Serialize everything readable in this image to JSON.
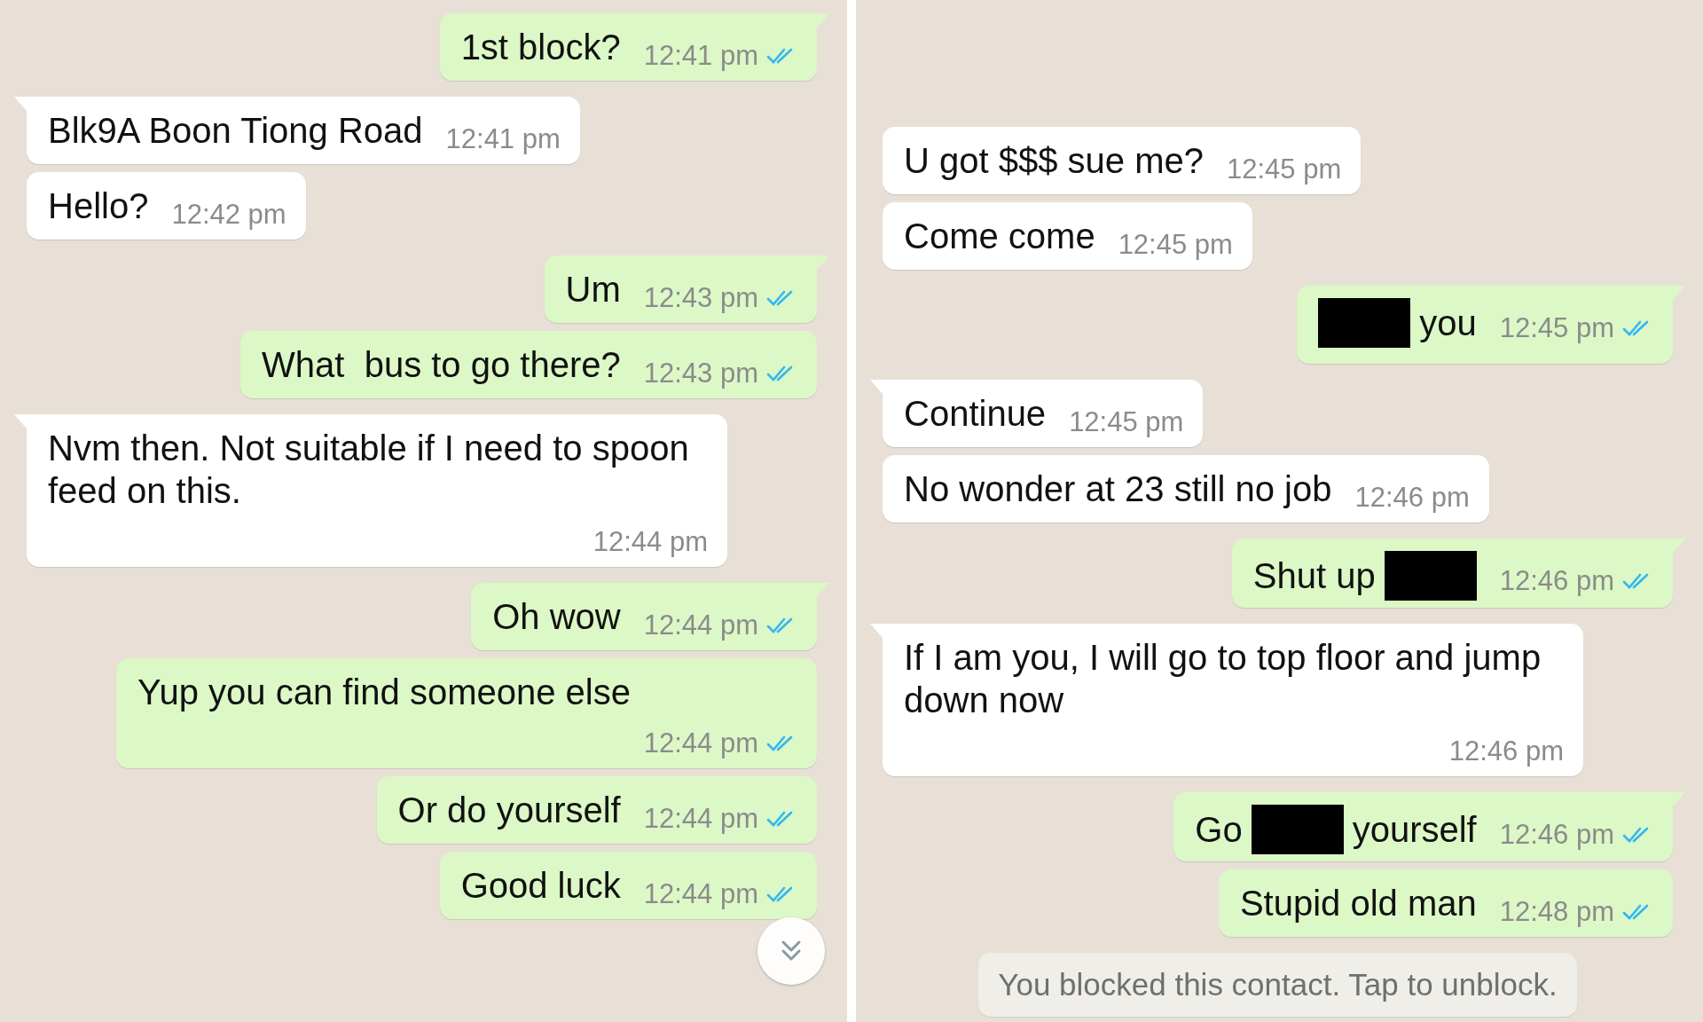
{
  "panels": [
    {
      "show_scroll_button": true,
      "messages": [
        {
          "kind": "outgoing",
          "tail": true,
          "text": "1st block?",
          "time": "12:41 pm",
          "read": true
        },
        {
          "kind": "incoming",
          "tail": true,
          "text": "Blk9A Boon Tiong Road",
          "time": "12:41 pm"
        },
        {
          "kind": "incoming",
          "tail": false,
          "text": "Hello?",
          "time": "12:42 pm"
        },
        {
          "kind": "outgoing",
          "tail": true,
          "text": "Um",
          "time": "12:43 pm",
          "read": true
        },
        {
          "kind": "outgoing",
          "tail": false,
          "text": "What  bus to go there?",
          "time": "12:43 pm",
          "read": true
        },
        {
          "kind": "incoming",
          "tail": true,
          "text": "Nvm then. Not suitable if I need to spoon feed on this.",
          "time": "12:44 pm"
        },
        {
          "kind": "outgoing",
          "tail": true,
          "text": "Oh wow",
          "time": "12:44 pm",
          "read": true
        },
        {
          "kind": "outgoing",
          "tail": false,
          "text": "Yup you can find someone else",
          "time": "12:44 pm",
          "read": true
        },
        {
          "kind": "outgoing",
          "tail": false,
          "text": "Or do yourself",
          "time": "12:44 pm",
          "read": true
        },
        {
          "kind": "outgoing",
          "tail": false,
          "text": "Good luck",
          "time": "12:44 pm",
          "read": true
        }
      ]
    },
    {
      "show_scroll_button": false,
      "messages": [
        {
          "kind": "incoming",
          "tail": false,
          "text": "U got $$$ sue me?",
          "time": "12:45 pm"
        },
        {
          "kind": "incoming",
          "tail": false,
          "text": "Come come",
          "time": "12:45 pm"
        },
        {
          "kind": "outgoing",
          "tail": true,
          "segments": [
            {
              "kind": "redaction"
            },
            {
              "kind": "text",
              "text": "you"
            }
          ],
          "time": "12:45 pm",
          "read": true
        },
        {
          "kind": "incoming",
          "tail": true,
          "text": "Continue",
          "time": "12:45 pm"
        },
        {
          "kind": "incoming",
          "tail": false,
          "text": "No wonder at 23 still no job",
          "time": "12:46 pm"
        },
        {
          "kind": "outgoing",
          "tail": true,
          "segments": [
            {
              "kind": "text",
              "text": "Shut up"
            },
            {
              "kind": "redaction"
            }
          ],
          "time": "12:46 pm",
          "read": true
        },
        {
          "kind": "incoming",
          "tail": true,
          "text": "If I am you, I will go to top floor and jump down now",
          "time": "12:46 pm"
        },
        {
          "kind": "outgoing",
          "tail": true,
          "segments": [
            {
              "kind": "text",
              "text": "Go"
            },
            {
              "kind": "redaction"
            },
            {
              "kind": "text",
              "text": "yourself"
            }
          ],
          "time": "12:46 pm",
          "read": true
        },
        {
          "kind": "outgoing",
          "tail": false,
          "text": "Stupid old man",
          "time": "12:48 pm",
          "read": true
        },
        {
          "kind": "system",
          "text": "You blocked this contact. Tap to unblock."
        }
      ]
    }
  ]
}
